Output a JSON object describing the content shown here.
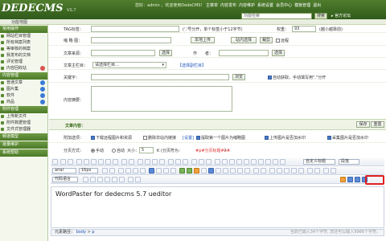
{
  "app": {
    "logo": "DEDECMS",
    "version": "V5.7",
    "welcome": "您好：admin ，欢迎使用DedeCMS！"
  },
  "top_links": [
    "主菜单",
    "内容发布",
    "内容维护",
    "系统设置",
    "会员中心",
    "模板管理",
    "退出"
  ],
  "function_nav": "功能地图",
  "search": {
    "placeholder": "功能检索",
    "button": "搜索",
    "official": "官方论坛"
  },
  "sidebar": {
    "sections": [
      {
        "title": "常用操作",
        "items": [
          "网站栏目管理",
          "所有档案列表",
          "等审核的档案",
          "我发布的文档",
          "评论管理",
          "内容回收站"
        ]
      },
      {
        "title": "内容管理",
        "items": [
          "普通文章",
          "图片集",
          "软件",
          "商品"
        ]
      },
      {
        "title": "附件管理",
        "items": [
          "上传新文件",
          "附件数据管理",
          "文件式管理器"
        ]
      },
      {
        "title": "频道模型",
        "items": []
      },
      {
        "title": "批量维护",
        "items": []
      },
      {
        "title": "系统帮助",
        "items": []
      }
    ]
  },
  "form": {
    "tag_label": "TAG标签：",
    "tag_hint": "(','号分开，单个标签小于12字节)",
    "weight_label": "权重：",
    "weight_value": "93",
    "weight_hint": "(越小越靠前)",
    "thumb_label": "缩 略 图：",
    "thumb_upload": "本地上传",
    "thumb_site": "站内选择",
    "thumb_crop": "裁剪",
    "thumb_remote": "远程",
    "source_label": "文章来源：",
    "source_select": "选择",
    "author_label": "作　　者：",
    "author_select": "选择",
    "column_label": "文章主栏目：",
    "column_value": "请选择栏目...",
    "column_sub": "【选择副栏目】",
    "keyword_label": "关键字：",
    "keyword_browse": "浏览",
    "keyword_auto": "自动获取，手动填写用\",\"分开",
    "desc_label": "内容摘要："
  },
  "body_section": {
    "title": "文章内容：",
    "save": "保存",
    "reset": "重置"
  },
  "options": {
    "label": "附加选项：",
    "items": [
      "下载远程图片和资源",
      "删除非站内链接",
      "[设置]",
      "提取第一个图片为缩略图",
      "上传图片是否加水印",
      "采集图片是否加水印"
    ]
  },
  "paging": {
    "label": "分页方式：",
    "manual": "手动",
    "auto": "自动",
    "size_label": "大小：",
    "size_value": "5",
    "size_unit": "K (分页符为：",
    "marker": "#p#分页标题#e#",
    "end": ")"
  },
  "editor": {
    "content": "WordPaster for dedecms 5.7 ueditor",
    "font_family": "arial",
    "font_size": "16px",
    "style": "段落",
    "custom_title": "自定义标题",
    "word_counter": "当前已输入34个字符, 您还可以输入9966个字符。",
    "path_label": "元素路径：",
    "path_body": "body",
    "path_p": "p",
    "code_lang": "代码语言"
  },
  "colors": {
    "brand": "#3c6a1f",
    "highlight": "#e02020",
    "accent": "#3a7bd5"
  }
}
